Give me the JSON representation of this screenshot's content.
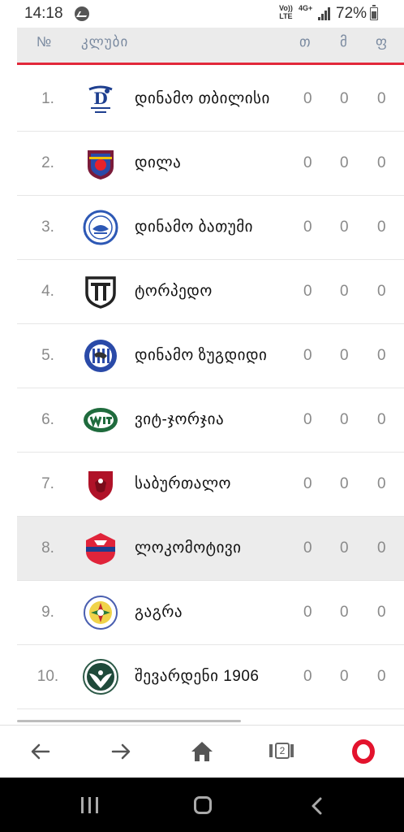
{
  "status_bar": {
    "time": "14:18",
    "network_top": "Vo))",
    "network_bottom": "LTE",
    "mobile_data": "4G+",
    "battery_percent": "72%",
    "battery_level": 0.72,
    "icons": [
      "messenger-icon",
      "signal-icon",
      "battery-icon"
    ]
  },
  "table": {
    "header": {
      "rank": "№",
      "club": "კლუბი",
      "col1": "თ",
      "col2": "მ",
      "col3": "ფ"
    },
    "highlight_color": "#ececec",
    "accent_color": "#e2283a",
    "rows": [
      {
        "rank": "1.",
        "name": "დინამო თბილისი",
        "v1": "0",
        "v2": "0",
        "v3": "0",
        "logo": "dinamo-tbilisi-logo",
        "highlight": false
      },
      {
        "rank": "2.",
        "name": "დილა",
        "v1": "0",
        "v2": "0",
        "v3": "0",
        "logo": "dila-logo",
        "highlight": false
      },
      {
        "rank": "3.",
        "name": "დინამო ბათუმი",
        "v1": "0",
        "v2": "0",
        "v3": "0",
        "logo": "dinamo-batumi-logo",
        "highlight": false
      },
      {
        "rank": "4.",
        "name": "ტორპედო",
        "v1": "0",
        "v2": "0",
        "v3": "0",
        "logo": "torpedo-logo",
        "highlight": false
      },
      {
        "rank": "5.",
        "name": "დინამო ზუგდიდი",
        "v1": "0",
        "v2": "0",
        "v3": "0",
        "logo": "dinamo-zugdidi-logo",
        "highlight": false
      },
      {
        "rank": "6.",
        "name": "ვიტ-ჯორჯია",
        "v1": "0",
        "v2": "0",
        "v3": "0",
        "logo": "wit-georgia-logo",
        "highlight": false
      },
      {
        "rank": "7.",
        "name": "საბურთალო",
        "v1": "0",
        "v2": "0",
        "v3": "0",
        "logo": "saburtalo-logo",
        "highlight": false
      },
      {
        "rank": "8.",
        "name": "ლოკომოტივი",
        "v1": "0",
        "v2": "0",
        "v3": "0",
        "logo": "lokomotivi-logo",
        "highlight": true
      },
      {
        "rank": "9.",
        "name": "გაგრა",
        "v1": "0",
        "v2": "0",
        "v3": "0",
        "logo": "gagra-logo",
        "highlight": false
      },
      {
        "rank": "10.",
        "name": "შევარდენი 1906",
        "v1": "0",
        "v2": "0",
        "v3": "0",
        "logo": "shevardeni-logo",
        "highlight": false
      }
    ]
  },
  "browser_toolbar": {
    "tab_count": "2",
    "icons": [
      "back-arrow-icon",
      "forward-arrow-icon",
      "home-icon",
      "tabs-icon",
      "opera-menu-icon"
    ],
    "opera_color": "#e3132d"
  },
  "system_nav": {
    "icons": [
      "recent-apps-icon",
      "home-circle-icon",
      "back-chevron-icon"
    ]
  }
}
